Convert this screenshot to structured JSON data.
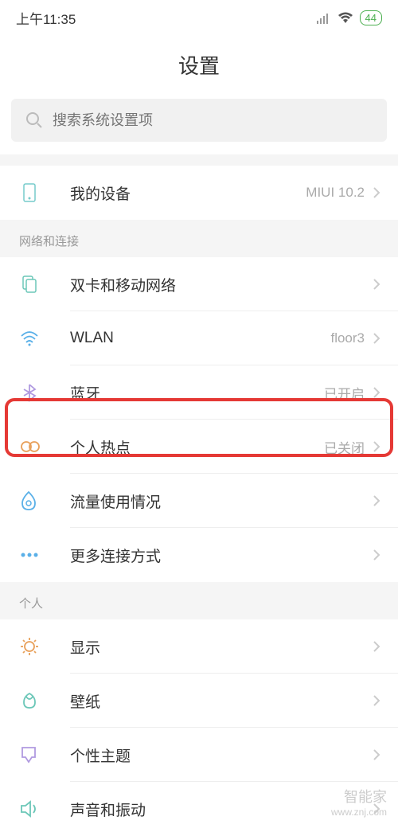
{
  "status": {
    "time": "上午11:35",
    "battery": "44"
  },
  "header": {
    "title": "设置"
  },
  "search": {
    "placeholder": "搜索系统设置项"
  },
  "device": {
    "label": "我的设备",
    "value": "MIUI 10.2"
  },
  "network": {
    "title": "网络和连接",
    "items": [
      {
        "label": "双卡和移动网络",
        "value": "",
        "icon": "sim"
      },
      {
        "label": "WLAN",
        "value": "floor3",
        "icon": "wifi"
      },
      {
        "label": "蓝牙",
        "value": "已开启",
        "icon": "bluetooth"
      },
      {
        "label": "个人热点",
        "value": "已关闭",
        "icon": "hotspot"
      },
      {
        "label": "流量使用情况",
        "value": "",
        "icon": "data"
      },
      {
        "label": "更多连接方式",
        "value": "",
        "icon": "more"
      }
    ]
  },
  "personal": {
    "title": "个人",
    "items": [
      {
        "label": "显示",
        "value": "",
        "icon": "display"
      },
      {
        "label": "壁纸",
        "value": "",
        "icon": "wallpaper"
      },
      {
        "label": "个性主题",
        "value": "",
        "icon": "theme"
      },
      {
        "label": "声音和振动",
        "value": "",
        "icon": "sound"
      }
    ]
  },
  "watermark": {
    "line1": "智能家",
    "line2": "www.znj.com"
  }
}
